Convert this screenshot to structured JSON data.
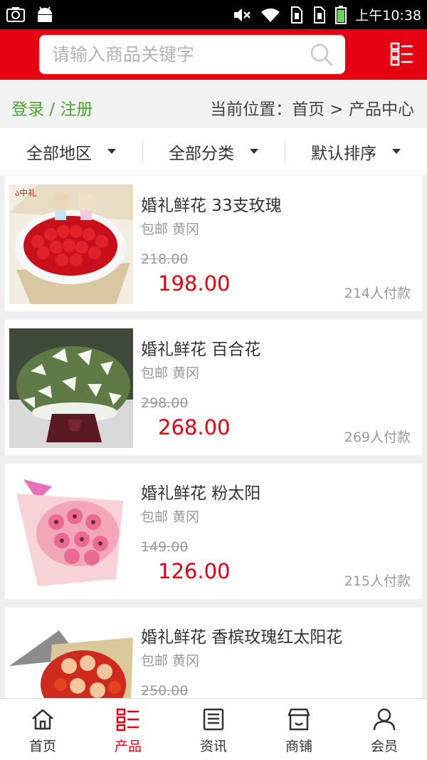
{
  "status_bar": {
    "time": "上午10:38"
  },
  "header": {
    "search_placeholder": "请输入商品关键字"
  },
  "breadcrumb": {
    "login_label": "登录 / 注册",
    "path": "当前位置：首页 > 产品中心"
  },
  "filters": [
    {
      "label": "全部地区"
    },
    {
      "label": "全部分类"
    },
    {
      "label": "默认排序"
    }
  ],
  "products": [
    {
      "title": "婚礼鲜花 33支玫瑰",
      "meta": "包邮 黄冈",
      "old_price": "218.00",
      "price": "198.00",
      "sold": "214人付款"
    },
    {
      "title": "婚礼鲜花 百合花",
      "meta": "包邮 黄冈",
      "old_price": "298.00",
      "price": "268.00",
      "sold": "269人付款"
    },
    {
      "title": "婚礼鲜花 粉太阳",
      "meta": "包邮 黄冈",
      "old_price": "149.00",
      "price": "126.00",
      "sold": "215人付款"
    },
    {
      "title": "婚礼鲜花 香槟玫瑰红太阳花",
      "meta": "包邮 黄冈",
      "old_price": "250.00",
      "price": "",
      "sold": ""
    }
  ],
  "bottom_nav": [
    {
      "label": "首页",
      "icon": "home-icon"
    },
    {
      "label": "产品",
      "icon": "products-icon"
    },
    {
      "label": "资讯",
      "icon": "news-icon"
    },
    {
      "label": "商铺",
      "icon": "shop-icon"
    },
    {
      "label": "会员",
      "icon": "member-icon"
    }
  ],
  "colors": {
    "brand": "#e50012",
    "login": "#4aa52e"
  }
}
